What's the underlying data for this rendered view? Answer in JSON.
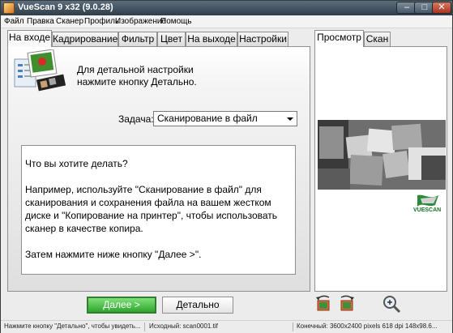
{
  "window": {
    "title": "VueScan 9 x32 (9.0.28)"
  },
  "menu": [
    "Файл",
    "Правка",
    "Сканер",
    "Профиль",
    "Изображение",
    "Помощь"
  ],
  "left_tabs": [
    {
      "label": "На входе",
      "active": true
    },
    {
      "label": "Кадрирование",
      "active": false
    },
    {
      "label": "Фильтр",
      "active": false
    },
    {
      "label": "Цвет",
      "active": false
    },
    {
      "label": "На выходе",
      "active": false
    },
    {
      "label": "Настройки",
      "active": false
    }
  ],
  "right_tabs": [
    {
      "label": "Просмотр",
      "active": true
    },
    {
      "label": "Скан",
      "active": false
    }
  ],
  "hint": {
    "line1": "Для детальной настройки",
    "line2": "нажмите кнопку Детально."
  },
  "task": {
    "label": "Задача:",
    "value": "Сканирование в файл"
  },
  "description": {
    "p1": "Что вы хотите делать?",
    "p2": "Например, используйте \"Сканирование в файл\" для сканирования и сохранения файла на вашем жестком диске и \"Копирование на принтер\", чтобы использовать сканер в качестве копира.",
    "p3": "Затем нажмите ниже кнопку \"Далее >\"."
  },
  "buttons": {
    "next": "Далее >",
    "detail": "Детально"
  },
  "logo": {
    "text": "VUESCAN"
  },
  "status": {
    "hint": "Нажмите кнопку \"Детально\", чтобы увидеть...",
    "source": "Исходный: scan0001.tif",
    "final": "Конечный: 3600x2400 pixels 618 dpi 148x98.6..."
  },
  "colors": {
    "next_button": "#2fa62f",
    "logo": "#1b6f2a"
  }
}
